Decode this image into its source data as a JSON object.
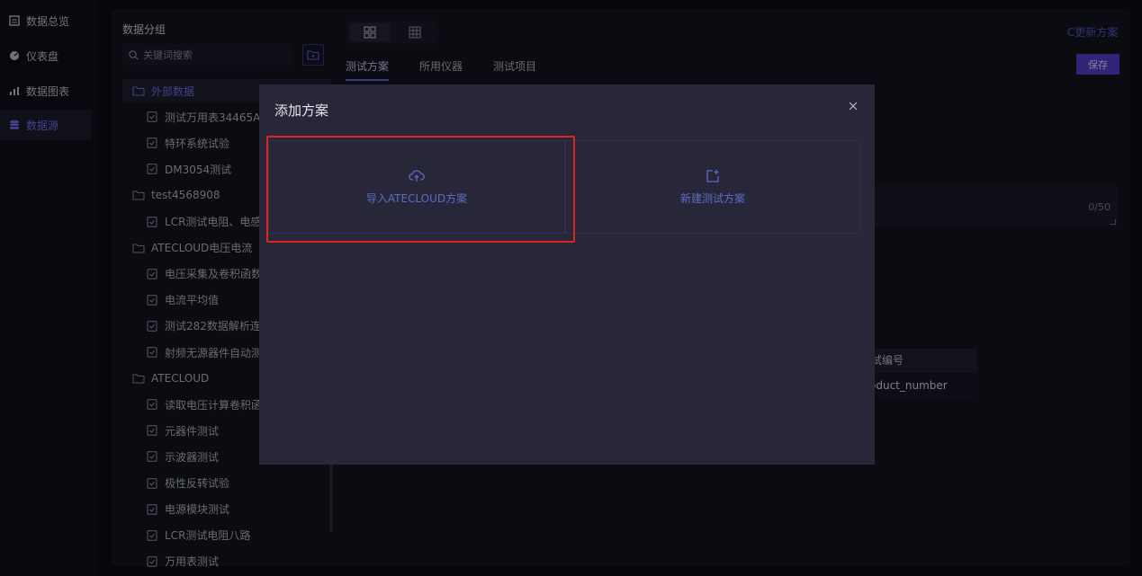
{
  "nav": {
    "items": [
      {
        "label": "数据总览",
        "icon": "overview-icon"
      },
      {
        "label": "仪表盘",
        "icon": "dashboard-icon"
      },
      {
        "label": "数据图表",
        "icon": "chart-icon"
      },
      {
        "label": "数据源",
        "icon": "database-icon"
      }
    ],
    "active_index": 3
  },
  "sidebar": {
    "title": "数据分组",
    "search_placeholder": "关键词搜索",
    "tree": [
      {
        "type": "folder",
        "label": "外部数据",
        "selected": true
      },
      {
        "type": "file",
        "label": "测试万用表34465A..."
      },
      {
        "type": "file",
        "label": "特环系统试验"
      },
      {
        "type": "file",
        "label": "DM3054测试"
      },
      {
        "type": "folder",
        "label": "test4568908"
      },
      {
        "type": "file",
        "label": "LCR测试电阻、电感"
      },
      {
        "type": "folder",
        "label": "ATECLOUD电压电流"
      },
      {
        "type": "file",
        "label": "电压采集及卷积函数"
      },
      {
        "type": "file",
        "label": "电流平均值"
      },
      {
        "type": "file",
        "label": "测试282数据解析连"
      },
      {
        "type": "file",
        "label": "射频无源器件自动测"
      },
      {
        "type": "folder",
        "label": "ATECLOUD"
      },
      {
        "type": "file",
        "label": "读取电压计算卷积函"
      },
      {
        "type": "file",
        "label": "元器件测试"
      },
      {
        "type": "file",
        "label": "示波器测试"
      },
      {
        "type": "file",
        "label": "极性反转试验"
      },
      {
        "type": "file",
        "label": "电源模块测试"
      },
      {
        "type": "file",
        "label": "LCR测试电阻八路"
      },
      {
        "type": "file",
        "label": "万用表测试"
      }
    ]
  },
  "main": {
    "refresh_label": "C更新方案",
    "tabs": [
      "测试方案",
      "所用仪器",
      "测试项目"
    ],
    "active_tab": 0,
    "save_label": "保存",
    "textarea_count": "0/50",
    "table": {
      "header": "试编号",
      "cell": "oduct_number"
    }
  },
  "modal": {
    "title": "添加方案",
    "close_symbol": "×",
    "options": [
      {
        "label": "导入ATECLOUD方案",
        "icon": "cloud-upload-icon"
      },
      {
        "label": "新建测试方案",
        "icon": "new-file-icon"
      }
    ]
  },
  "colors": {
    "accent": "#6a5ee0",
    "highlight": "#e02424",
    "link": "#5d6cc4"
  }
}
